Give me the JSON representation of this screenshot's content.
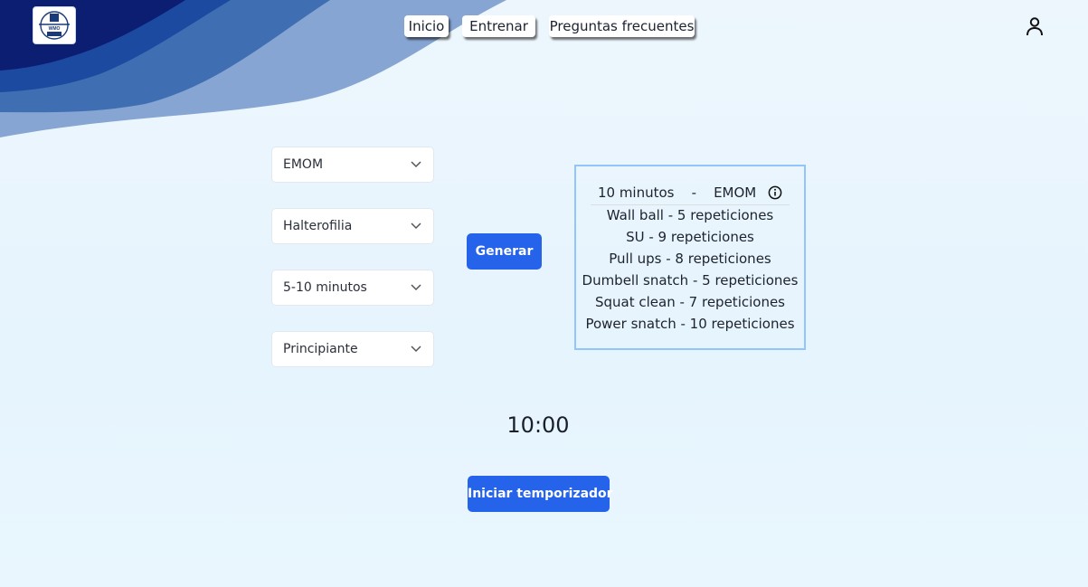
{
  "nav": {
    "inicio": "Inicio",
    "entrenar": "Entrenar",
    "faq": "Preguntas frecuentes"
  },
  "logo": {
    "text": "WMO"
  },
  "filters": {
    "type": "EMOM",
    "category": "Halterofilia",
    "duration": "5-10 minutos",
    "level": "Principiante"
  },
  "actions": {
    "generate": "Generar",
    "start_timer": "Iniciar temporizador"
  },
  "workout": {
    "duration": "10 minutos",
    "separator": "-",
    "format": "EMOM",
    "exercises": [
      "Wall ball - 5 repeticiones",
      "SU - 9 repeticiones",
      "Pull ups - 8 repeticiones",
      "Dumbell snatch - 5 repeticiones",
      "Squat clean - 7 repeticiones",
      "Power snatch - 10 repeticiones"
    ]
  },
  "timer": {
    "display": "10:00"
  },
  "colors": {
    "primary": "#2563eb",
    "wave_dark": "#0a1d6e",
    "wave_mid": "#1f4fa0",
    "wave_light": "#7f9fcd",
    "box_border": "#93c5fd"
  },
  "icons": [
    "user-icon",
    "chevron-down-icon",
    "info-icon"
  ]
}
